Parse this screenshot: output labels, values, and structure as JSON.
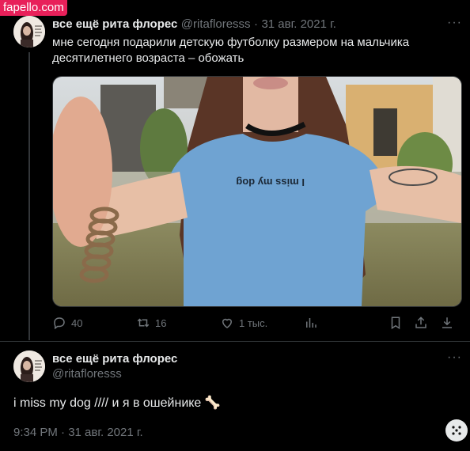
{
  "watermark": "fapello.com",
  "tweet1": {
    "name": "все ещё рита флорес",
    "handle": "@ritafloresss",
    "date": "31 авг. 2021 г.",
    "text_line1": "мне сегодня подарили детскую футболку размером на мальчика",
    "text_line2": "десятилетнего возраста – обожать",
    "shirt_text": "I miss my dog",
    "actions": {
      "replies": "40",
      "retweets": "16",
      "likes": "1 тыс."
    }
  },
  "tweet2": {
    "name": "все ещё рита флорес",
    "handle": "@ritafloresss",
    "text": "i miss my dog //// и я в ошейнике",
    "emoji": "🦴",
    "timestamp": "9:34 PM · 31 авг. 2021 г."
  },
  "colors": {
    "background": "#000000",
    "text": "#e7e9ea",
    "muted": "#71767b",
    "divider": "#2f3336",
    "watermark": "#e8205a",
    "shirt": "#6fa3d2"
  },
  "icons": [
    "reply-icon",
    "retweet-icon",
    "like-icon",
    "views-icon",
    "bookmark-icon",
    "share-icon",
    "more-icon",
    "options-icon"
  ]
}
